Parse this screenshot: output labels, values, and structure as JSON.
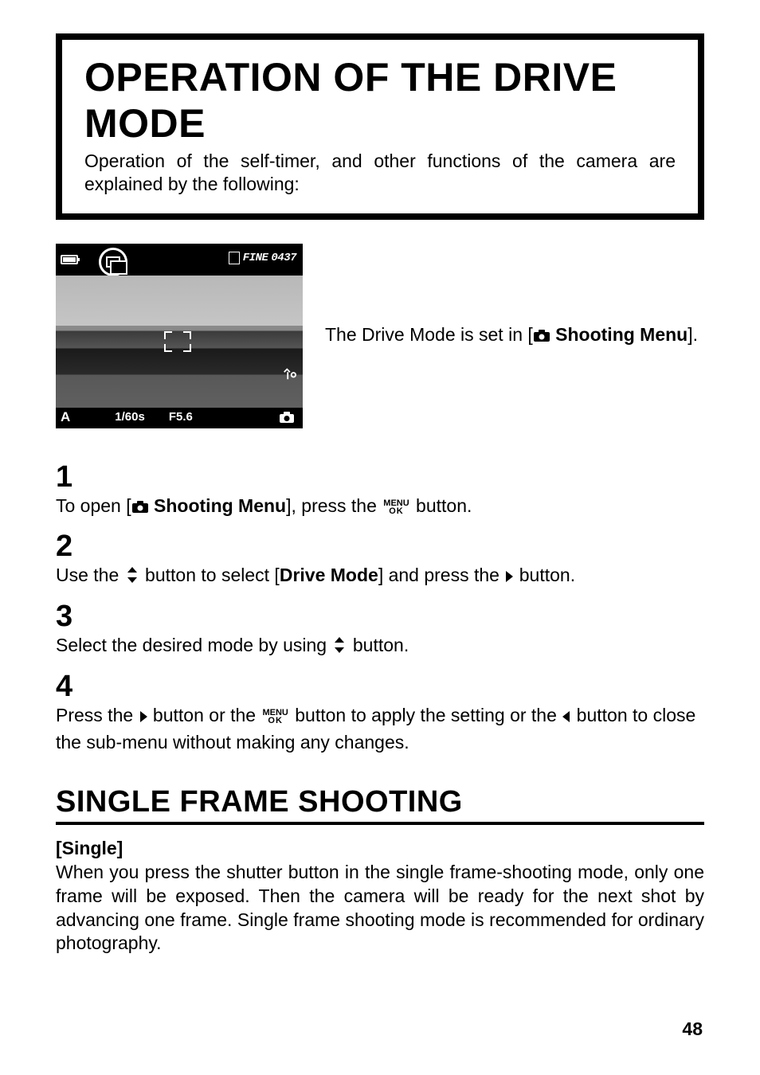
{
  "title_box": {
    "heading": "OPERATION OF THE DRIVE MODE",
    "subtext": "Operation of the self-timer, and other functions of the camera are explained by the following:"
  },
  "screenshot": {
    "fine_label": "FINE",
    "counter": "0437",
    "mode": "A",
    "shutter": "1/60s",
    "aperture": "F5.6"
  },
  "intro": {
    "prefix": "The Drive Mode is set in [",
    "bold": " Shooting Menu",
    "suffix": "]."
  },
  "steps": [
    {
      "num": "1",
      "parts": {
        "a": "To open [",
        "b": " Shooting Menu",
        "c": "], press the ",
        "d": " button."
      }
    },
    {
      "num": "2",
      "parts": {
        "a": "Use the ",
        "b": " button to select [",
        "c": "Drive Mode",
        "d": "] and press the ",
        "e": " button."
      }
    },
    {
      "num": "3",
      "parts": {
        "a": "Select the desired mode by using ",
        "b": " button."
      }
    },
    {
      "num": "4",
      "parts": {
        "a": "Press the ",
        "b": " button or the ",
        "c": " button to apply the setting or the ",
        "d": " button to close the sub-menu without making any changes."
      }
    }
  ],
  "section": {
    "heading": "SINGLE FRAME SHOOTING",
    "subhead": "[Single]",
    "body": "When you press the shutter button in the single frame-shooting mode, only one frame will be exposed. Then the camera will be ready for the next shot by advancing one frame. Single frame shooting mode is recommended for ordinary photography."
  },
  "menu_ok": {
    "line1": "MENU",
    "line2": "OK"
  },
  "page_number": "48"
}
